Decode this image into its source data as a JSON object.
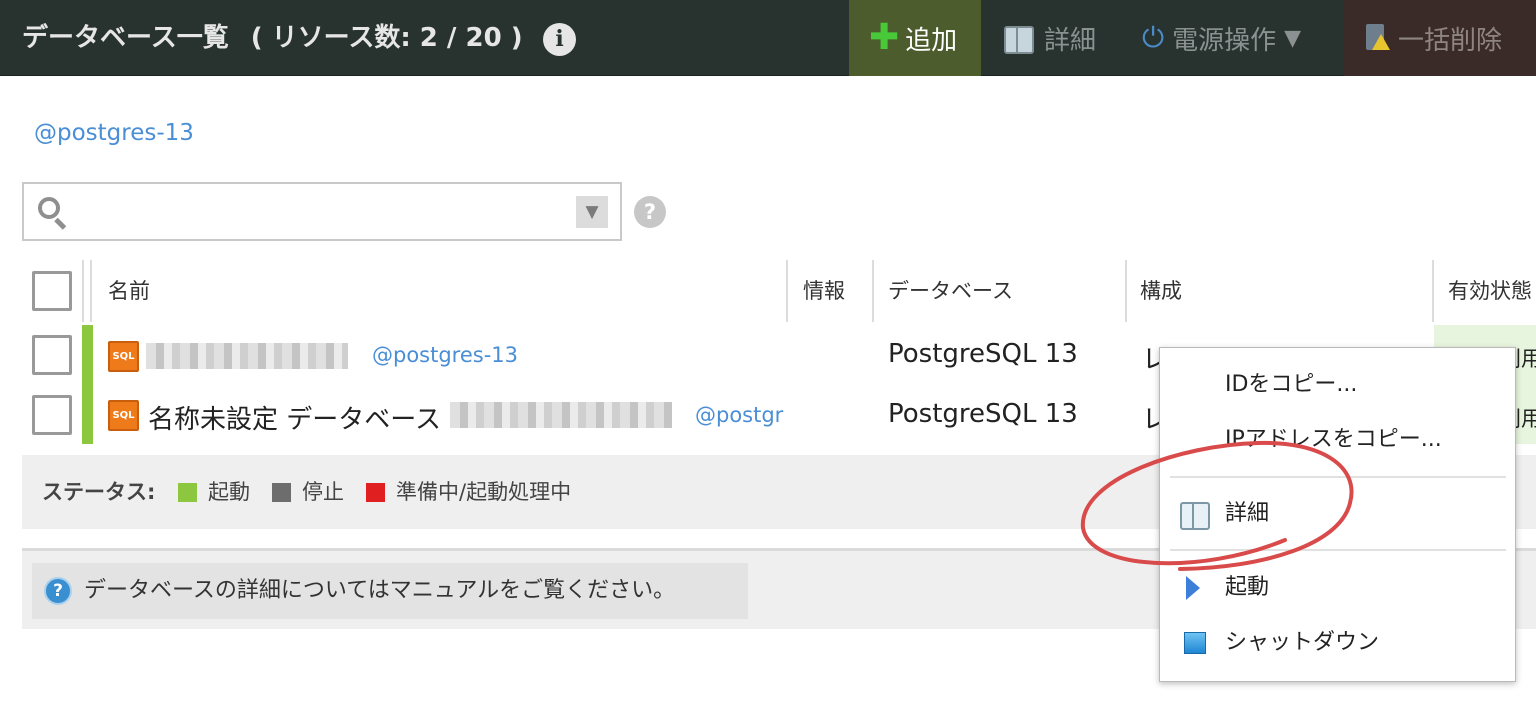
{
  "header": {
    "title": "データベース一覧",
    "resource_count": "( リソース数: 2 / 20 )",
    "info_icon": "i",
    "toolbar": {
      "add_label": "追加",
      "detail_label": "詳細",
      "power_label": "電源操作",
      "power_caret": "▼",
      "delete_label": "一括削除"
    }
  },
  "filter": {
    "tag": "@postgres-13"
  },
  "search": {
    "placeholder": "",
    "dropdown_glyph": "▼",
    "help_glyph": "?"
  },
  "table": {
    "columns": [
      "名前",
      "情報",
      "データベース",
      "構成",
      "有効状態"
    ],
    "rows": [
      {
        "icon": "SQL",
        "name": "",
        "tag": "@postgres-13",
        "database": "PostgreSQL 13",
        "config": "レ",
        "enabled": "利用"
      },
      {
        "icon": "SQL",
        "name": "名称未設定 データベース",
        "tag": "@postgr",
        "database": "PostgreSQL 13",
        "config": "レ",
        "enabled": "利用"
      }
    ]
  },
  "legend": {
    "label": "ステータス:",
    "items": [
      {
        "text": "起動",
        "color": "#8dc63f"
      },
      {
        "text": "停止",
        "color": "#6d6d6d"
      },
      {
        "text": "準備中/起動処理中",
        "color": "#e02020"
      }
    ]
  },
  "manual": {
    "text": "データベースの詳細についてはマニュアルをご覧ください。",
    "icon_glyph": "?"
  },
  "context_menu": {
    "items": [
      {
        "label": "IDをコピー...",
        "icon": "none"
      },
      {
        "label": "IPアドレスをコピー...",
        "icon": "none"
      },
      {
        "label": "詳細",
        "icon": "book-icon"
      },
      {
        "label": "起動",
        "icon": "play-icon"
      },
      {
        "label": "シャットダウン",
        "icon": "stop-square-icon"
      }
    ]
  },
  "colors": {
    "header_bg": "#283330",
    "add_button_bg": "#4c5c2c",
    "delete_button_bg": "#3a2b28",
    "link": "#4a8ed6",
    "status_running": "#8dc63f",
    "annotation_circle": "#d94a4a"
  }
}
